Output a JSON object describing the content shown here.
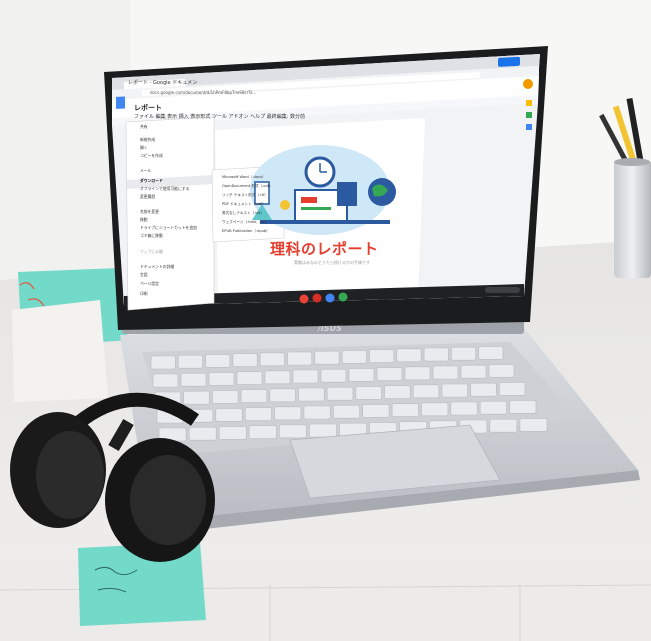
{
  "browser": {
    "tab_title": "レポート - Google ドキュメン",
    "url": "docs.google.com/document/d/1hPmF8bpTneS8crTa..."
  },
  "doc": {
    "name": "レポート",
    "menubar": "ファイル  編集  表示  挿入  表示形式  ツール  アドオン  ヘルプ  最終編集: 数分前",
    "share": "共有",
    "title": "理科のレポート",
    "subtitle": "実験はみなのどうたら続けるかの手順です"
  },
  "file_menu": {
    "items": [
      {
        "label": "共有"
      },
      {
        "label": "新規作成"
      },
      {
        "label": "開く"
      },
      {
        "label": "コピーを作成"
      },
      {
        "label": "メール"
      },
      {
        "label": "ダウンロード",
        "highlighted": true
      },
      {
        "label": "オフラインで使用可能にする"
      },
      {
        "label": "変更履歴"
      },
      {
        "label": "名前を変更"
      },
      {
        "label": "移動"
      },
      {
        "label": "ドライブにショートカットを追加"
      },
      {
        "label": "ゴミ箱に移動"
      },
      {
        "label": "ウェブに公開",
        "dim": true
      },
      {
        "label": "ドキュメントの詳細"
      },
      {
        "label": "言語"
      },
      {
        "label": "ページ設定"
      },
      {
        "label": "印刷"
      }
    ]
  },
  "download_menu": {
    "items": [
      {
        "label": "Microsoft Word（.docx）"
      },
      {
        "label": "OpenDocument 形式（.odt）"
      },
      {
        "label": "リッチ テキスト形式（.rtf）"
      },
      {
        "label": "PDF ドキュメント（.pdf）"
      },
      {
        "label": "書式なしテキスト（.txt）"
      },
      {
        "label": "ウェブページ（.html, .zip）"
      },
      {
        "label": "EPUB Publication（.epub）"
      }
    ]
  },
  "laptop": {
    "brand": "/ISUS"
  },
  "colors": {
    "title_red": "#e53d2e",
    "docs_blue": "#4285f4",
    "sticky_teal": "#6fd6c6",
    "pencil_yellow": "#f2c431"
  }
}
